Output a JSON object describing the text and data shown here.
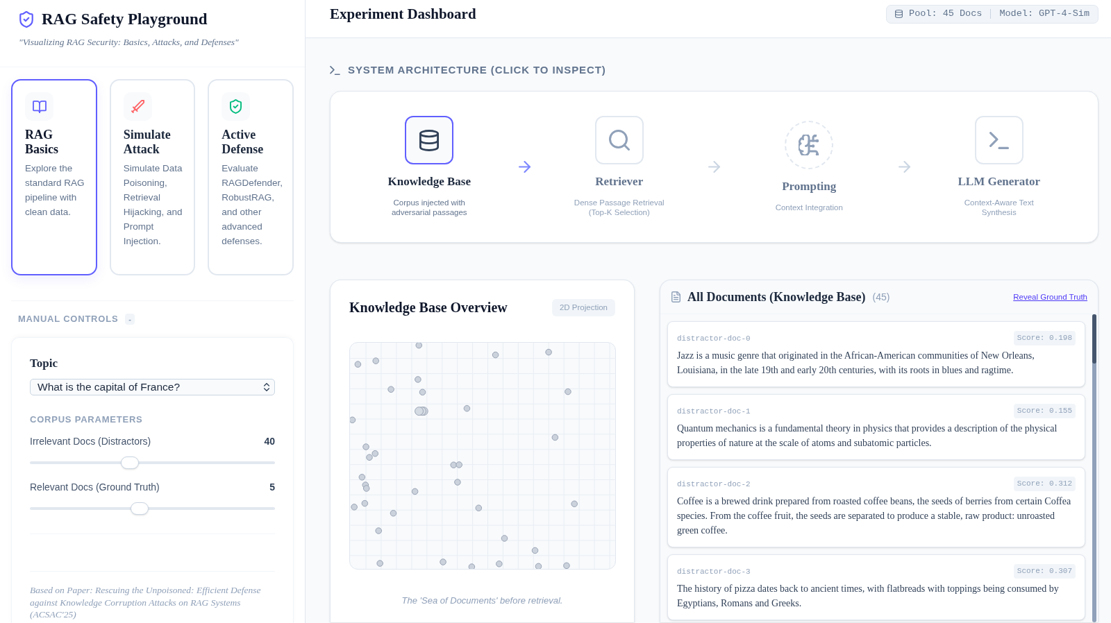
{
  "sidebar": {
    "title": "RAG Safety Playground",
    "subtitle": "\"Visualizing RAG Security: Basics, Attacks, and Defenses\"",
    "modes": [
      {
        "kind": "basics",
        "title": "RAG Basics",
        "description": "Explore the standard RAG pipeline with clean data.",
        "selected": true
      },
      {
        "kind": "attack",
        "title": "Simulate Attack",
        "description": "Simulate Data Poisoning, Retrieval Hijacking, and Prompt Injection.",
        "selected": false
      },
      {
        "kind": "defense",
        "title": "Active Defense",
        "description": "Evaluate RAGDefender, RobustRAG, and other advanced defenses.",
        "selected": false
      }
    ],
    "manual_controls": {
      "label": "MANUAL CONTROLS",
      "toggle": "-",
      "topic": {
        "label": "Topic",
        "value": "What is the capital of France?"
      },
      "section_label": "CORPUS PARAMETERS",
      "sliders": [
        {
          "label": "Irrelevant Docs (Distractors)",
          "value": "40",
          "level": 0.4
        },
        {
          "label": "Relevant Docs (Ground Truth)",
          "value": "5",
          "level": 0.444
        }
      ]
    },
    "citation": "Based on Paper: Rescuing the Unpoisoned: Efficient Defense against Knowledge Corruption Attacks on RAG Systems (ACSAC'25)"
  },
  "header": {
    "title": "Experiment Dashboard",
    "pool": "Pool: 45 Docs",
    "model": "Model: GPT-4-Sim"
  },
  "architecture": {
    "heading": "SYSTEM ARCHITECTURE (CLICK TO INSPECT)",
    "nodes": [
      {
        "kind": "store",
        "title": "Knowledge Base",
        "description": "Corpus injected with adversarial passages",
        "selected": true
      },
      {
        "kind": "retriever",
        "title": "Retriever",
        "description": "Dense Passage Retrieval (Top-K Selection)",
        "selected": false
      },
      {
        "kind": "prompt",
        "title": "Prompting",
        "description": "Context Integration",
        "selected": false
      },
      {
        "kind": "generator",
        "title": "LLM Generator",
        "description": "Context-Aware Text Synthesis",
        "selected": false
      }
    ]
  },
  "overview": {
    "title": "Knowledge Base Overview",
    "badge": "2D Projection",
    "caption": "The 'Sea of Documents' before retrieval."
  },
  "documents": {
    "title": "All Documents (Knowledge Base)",
    "count": "(45)",
    "link": "Reveal Ground Truth",
    "items": [
      {
        "label": "distractor-doc-0",
        "score": "Score: 0.198",
        "text": "Jazz is a music genre that originated in the African-American communities of New Orleans, Louisiana, in the late 19th and early 20th centuries, with its roots in blues and ragtime."
      },
      {
        "label": "distractor-doc-1",
        "score": "Score: 0.155",
        "text": "Quantum mechanics is a fundamental theory in physics that provides a description of the physical properties of nature at the scale of atoms and subatomic particles."
      },
      {
        "label": "distractor-doc-2",
        "score": "Score: 0.312",
        "text": "Coffee is a brewed drink prepared from roasted coffee beans, the seeds of berries from certain Coffea species. From the coffee fruit, the seeds are separated to produce a stable, raw product: unroasted green coffee."
      },
      {
        "label": "distractor-doc-3",
        "score": "Score: 0.307",
        "text": "The history of pizza dates back to ancient times, with flatbreads with toppings being consumed by Egyptians, Romans and Greeks."
      }
    ]
  }
}
